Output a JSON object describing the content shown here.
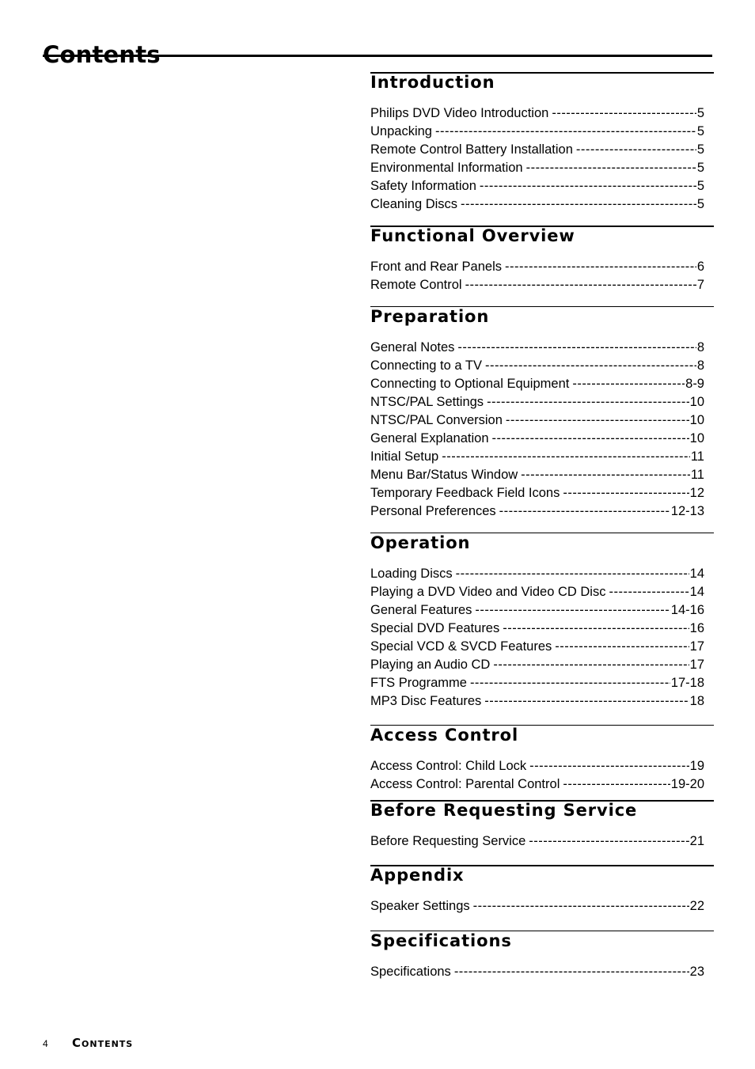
{
  "page": {
    "title": "Contents",
    "footer": {
      "page_number": "4",
      "label": "Contents"
    }
  },
  "sections": [
    {
      "heading": "Introduction",
      "entries": [
        {
          "label": "Philips DVD Video Introduction",
          "page": "5"
        },
        {
          "label": "Unpacking",
          "page": "5"
        },
        {
          "label": "Remote Control Battery Installation",
          "page": "5"
        },
        {
          "label": "Environmental Information",
          "page": "5"
        },
        {
          "label": "Safety Information",
          "page": "5"
        },
        {
          "label": "Cleaning Discs",
          "page": "5"
        }
      ]
    },
    {
      "heading": "Functional Overview",
      "entries": [
        {
          "label": "Front and Rear Panels",
          "page": "6"
        },
        {
          "label": "Remote Control",
          "page": "7"
        }
      ]
    },
    {
      "heading": "Preparation",
      "entries": [
        {
          "label": "General Notes",
          "page": "8"
        },
        {
          "label": "Connecting to a TV",
          "page": "8"
        },
        {
          "label": "Connecting to Optional Equipment",
          "page": "8-9"
        },
        {
          "label": "NTSC/PAL Settings",
          "page": "10"
        },
        {
          "label": "NTSC/PAL Conversion",
          "page": "10"
        },
        {
          "label": "General Explanation",
          "page": "10"
        },
        {
          "label": "Initial Setup",
          "page": "11"
        },
        {
          "label": "Menu Bar/Status Window",
          "page": "11"
        },
        {
          "label": "Temporary Feedback Field Icons",
          "page": "12"
        },
        {
          "label": "Personal Preferences",
          "page": "12-13"
        }
      ]
    },
    {
      "heading": "Operation",
      "entries": [
        {
          "label": "Loading Discs",
          "page": "14"
        },
        {
          "label": "Playing a DVD Video and Video CD Disc",
          "page": "14"
        },
        {
          "label": "General Features",
          "page": "14-16"
        },
        {
          "label": "Special DVD Features",
          "page": "16"
        },
        {
          "label": "Special VCD & SVCD Features",
          "page": "17"
        },
        {
          "label": "Playing an Audio CD",
          "page": "17"
        },
        {
          "label": "FTS Programme",
          "page": "17-18"
        },
        {
          "label": "MP3 Disc Features",
          "page": "18"
        }
      ]
    },
    {
      "heading": "Access Control",
      "entries": [
        {
          "label": "Access Control: Child Lock",
          "page": "19"
        },
        {
          "label": "Access Control: Parental Control",
          "page": "19-20"
        }
      ]
    },
    {
      "heading": "Before Requesting Service",
      "entries": [
        {
          "label": "Before Requesting Service",
          "page": "21"
        }
      ]
    },
    {
      "heading": "Appendix",
      "entries": [
        {
          "label": "Speaker Settings",
          "page": "22"
        }
      ]
    },
    {
      "heading": "Specifications",
      "entries": [
        {
          "label": "Specifications",
          "page": "23"
        }
      ]
    }
  ]
}
